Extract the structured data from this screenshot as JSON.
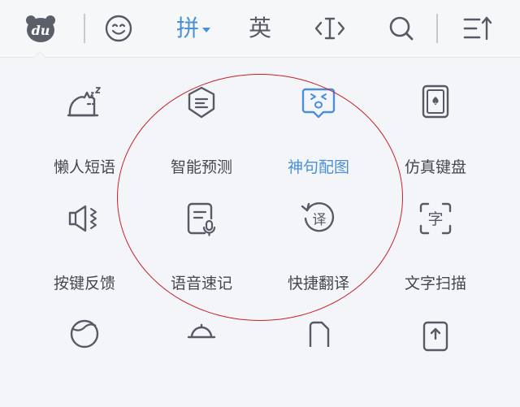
{
  "toolbar": {
    "logo_text": "du",
    "pinyin_label": "拼",
    "english_label": "英",
    "icons": [
      "du-logo-icon",
      "emoji-icon",
      "cursor-move-icon",
      "search-icon",
      "collapse-icon"
    ]
  },
  "tiles": [
    {
      "label": "懒人短语",
      "icon": "lazy-cat-icon"
    },
    {
      "label": "智能预测",
      "icon": "smart-predict-icon"
    },
    {
      "label": "神句配图",
      "icon": "meme-image-icon",
      "active": true
    },
    {
      "label": "仿真键盘",
      "icon": "realistic-keyboard-icon"
    },
    {
      "label": "按键反馈",
      "icon": "key-feedback-icon"
    },
    {
      "label": "语音速记",
      "icon": "voice-note-icon"
    },
    {
      "label": "快捷翻译",
      "icon": "quick-translate-icon"
    },
    {
      "label": "文字扫描",
      "icon": "text-scan-icon"
    }
  ],
  "colors": {
    "accent": "#4a8fd8",
    "text": "#44474e",
    "icon_gray": "#555a64",
    "highlight_circle": "#c8202a",
    "background": "#f4f5f8"
  }
}
